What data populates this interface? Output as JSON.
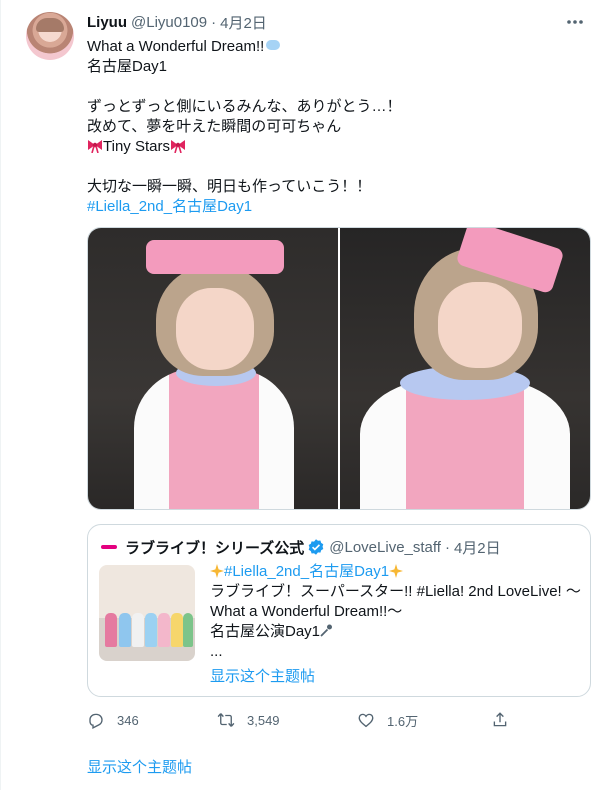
{
  "tweet": {
    "display_name": "Liyuu",
    "handle": "@Liyu0109",
    "separator": "·",
    "date": "4月2日",
    "more_icon": "more-horizontal-icon",
    "lines": {
      "l1": "What a Wonderful Dream!!",
      "l2": "名古屋Day1",
      "l3": "ずっとずっと側にいるみんな、ありがとう…！",
      "l4": "改めて、夢を叶えた瞬間の可可ちゃん",
      "l5": "Tiny Stars",
      "l6": "大切な一瞬一瞬、明日も作っていこう！！",
      "l7": "#Liella_2nd_名古屋Day1"
    }
  },
  "quote": {
    "brand_icon": "lovelive-logo-icon",
    "name": "ラブライブ！シリーズ公式",
    "verified_icon": "verified-badge-icon",
    "handle": "@LoveLive_staff",
    "separator": "·",
    "date": "4月2日",
    "lines": {
      "l1": "#Liella_2nd_名古屋Day1",
      "l2": "ラブライブ！スーパースター!! #Liella! 2nd LoveLive! 〜",
      "l3": "What a Wonderful Dream!!〜",
      "l4": "名古屋公演Day1",
      "l5": "..."
    },
    "show_thread": "显示这个主题帖"
  },
  "actions": {
    "reply_count": "346",
    "retweet_count": "3,549",
    "like_count": "1.6万",
    "icons": [
      "reply-icon",
      "retweet-icon",
      "like-icon",
      "share-icon"
    ]
  },
  "footer": {
    "show_thread": "显示这个主题帖"
  },
  "colors": {
    "accent": "#1d9bf0",
    "text": "#0f1419",
    "secondary": "#536471",
    "border": "#cfd9de",
    "brand": "#e4007f"
  }
}
